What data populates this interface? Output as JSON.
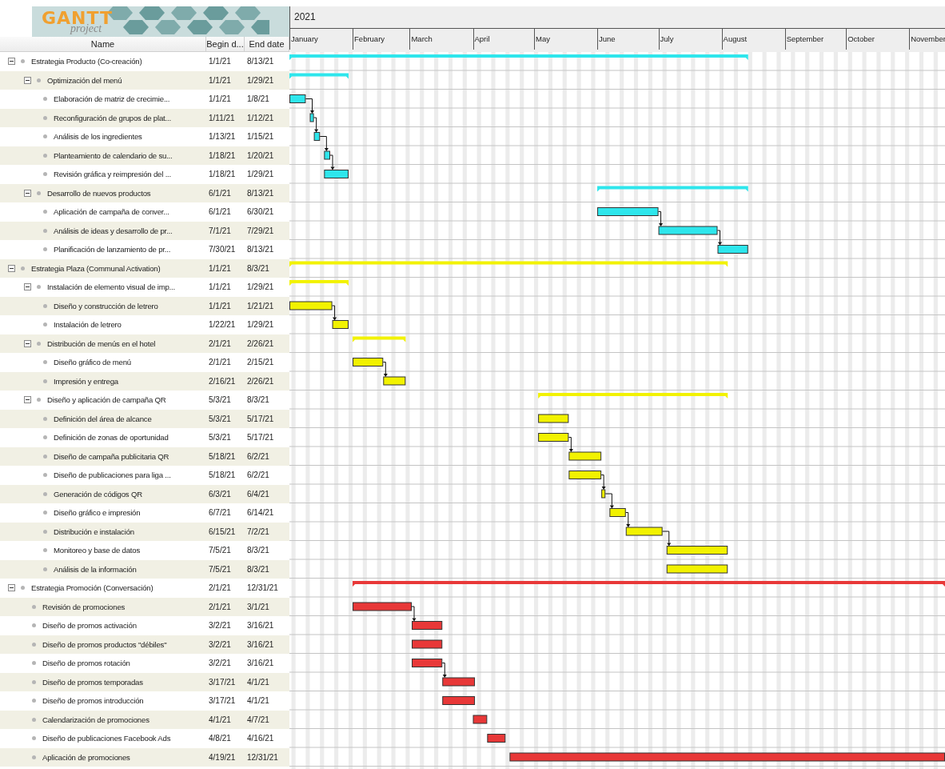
{
  "logo": {
    "title": "GANTT",
    "subtitle": "project"
  },
  "columns": [
    "Name",
    "Begin d...",
    "End date"
  ],
  "year": "2021",
  "months": [
    "January",
    "February",
    "March",
    "April",
    "May",
    "June",
    "July",
    "August",
    "September",
    "October",
    "November"
  ],
  "tasks": [
    {
      "name": "Estrategia Producto (Co-creación)",
      "begin": "1/1/21",
      "end": "8/13/21",
      "expanded": true,
      "color": "#2ee6ec",
      "children": [
        {
          "name": "Optimización del menú",
          "begin": "1/1/21",
          "end": "1/29/21",
          "expanded": true,
          "children": [
            {
              "name": "Elaboración de matriz de crecimie...",
              "begin": "1/1/21",
              "end": "1/8/21",
              "linked": false
            },
            {
              "name": "Reconfiguración de grupos de plat...",
              "begin": "1/11/21",
              "end": "1/12/21",
              "linked": true
            },
            {
              "name": "Análisis de los ingredientes",
              "begin": "1/13/21",
              "end": "1/15/21",
              "linked": true
            },
            {
              "name": "Planteamiento de calendario de su...",
              "begin": "1/18/21",
              "end": "1/20/21",
              "linked": true
            },
            {
              "name": "Revisión gráfica y reimpresión del ...",
              "begin": "1/18/21",
              "end": "1/29/21",
              "linked": true
            }
          ]
        },
        {
          "name": "Desarrollo de nuevos productos",
          "begin": "6/1/21",
          "end": "8/13/21",
          "expanded": true,
          "children": [
            {
              "name": "Aplicación de campaña de conver...",
              "begin": "6/1/21",
              "end": "6/30/21",
              "linked": false
            },
            {
              "name": "Análisis de ideas y desarrollo de pr...",
              "begin": "7/1/21",
              "end": "7/29/21",
              "linked": true
            },
            {
              "name": "Planificación de lanzamiento de pr...",
              "begin": "7/30/21",
              "end": "8/13/21",
              "linked": true
            }
          ]
        }
      ]
    },
    {
      "name": "Estrategia Plaza (Communal Activation)",
      "begin": "1/1/21",
      "end": "8/3/21",
      "expanded": true,
      "color": "#f2f200",
      "children": [
        {
          "name": "Instalación de elemento visual de imp...",
          "begin": "1/1/21",
          "end": "1/29/21",
          "expanded": true,
          "children": [
            {
              "name": "Diseño y construcción de letrero",
              "begin": "1/1/21",
              "end": "1/21/21",
              "linked": false
            },
            {
              "name": "Instalación de letrero",
              "begin": "1/22/21",
              "end": "1/29/21",
              "linked": true
            }
          ]
        },
        {
          "name": "Distribución de menús en el hotel",
          "begin": "2/1/21",
          "end": "2/26/21",
          "expanded": true,
          "children": [
            {
              "name": "Diseño gráfico de menú",
              "begin": "2/1/21",
              "end": "2/15/21",
              "linked": false
            },
            {
              "name": "Impresión y entrega",
              "begin": "2/16/21",
              "end": "2/26/21",
              "linked": true
            }
          ]
        },
        {
          "name": "Diseño y aplicación de campaña QR",
          "begin": "5/3/21",
          "end": "8/3/21",
          "expanded": true,
          "children": [
            {
              "name": "Definición del área de alcance",
              "begin": "5/3/21",
              "end": "5/17/21",
              "linked": false
            },
            {
              "name": "Definición de zonas de oportunidad",
              "begin": "5/3/21",
              "end": "5/17/21",
              "linked": false
            },
            {
              "name": "Diseño de campaña publicitaria QR",
              "begin": "5/18/21",
              "end": "6/2/21",
              "linked": true
            },
            {
              "name": "Diseño de publicaciones para liga ...",
              "begin": "5/18/21",
              "end": "6/2/21",
              "linked": false
            },
            {
              "name": "Generación de códigos QR",
              "begin": "6/3/21",
              "end": "6/4/21",
              "linked": true
            },
            {
              "name": "Diseño gráfico e impresión",
              "begin": "6/7/21",
              "end": "6/14/21",
              "linked": true
            },
            {
              "name": "Distribución e instalación",
              "begin": "6/15/21",
              "end": "7/2/21",
              "linked": true
            },
            {
              "name": "Monitoreo y base de datos",
              "begin": "7/5/21",
              "end": "8/3/21",
              "linked": true
            },
            {
              "name": "Análisis de la información",
              "begin": "7/5/21",
              "end": "8/3/21",
              "linked": false
            }
          ]
        }
      ]
    },
    {
      "name": "Estrategia Promoción (Conversación)",
      "begin": "2/1/21",
      "end": "12/31/21",
      "expanded": true,
      "color": "#e83838",
      "children": [
        {
          "name": "Revisión de promociones",
          "begin": "2/1/21",
          "end": "3/1/21",
          "linked": false
        },
        {
          "name": "Diseño de promos activación",
          "begin": "3/2/21",
          "end": "3/16/21",
          "linked": true
        },
        {
          "name": "Diseño de promos productos \"débiles\"",
          "begin": "3/2/21",
          "end": "3/16/21",
          "linked": false
        },
        {
          "name": "Diseño de promos rotación",
          "begin": "3/2/21",
          "end": "3/16/21",
          "linked": false
        },
        {
          "name": "Diseño de promos temporadas",
          "begin": "3/17/21",
          "end": "4/1/21",
          "linked": true
        },
        {
          "name": "Diseño de promos introducción",
          "begin": "3/17/21",
          "end": "4/1/21",
          "linked": false
        },
        {
          "name": "Calendarización de promociones",
          "begin": "4/1/21",
          "end": "4/7/21",
          "linked": false
        },
        {
          "name": "Diseño de publicaciones Facebook Ads",
          "begin": "4/8/21",
          "end": "4/16/21",
          "linked": false
        },
        {
          "name": "Aplicación de promociones",
          "begin": "4/19/21",
          "end": "12/31/21",
          "linked": false
        }
      ]
    }
  ]
}
